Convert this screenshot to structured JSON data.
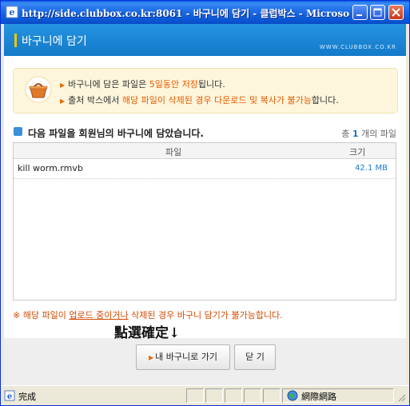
{
  "window": {
    "title": "http://side.clubbox.co.kr:8061 - 바구니에 담기 - 클럽박스 - Microsoft..."
  },
  "header": {
    "title": "바구니에 담기",
    "site": "WWW.CLUBBOX.CO.KR"
  },
  "notice": {
    "line1_pre": "바구니에 담은 파일은 ",
    "line1_hl": "5일동안 저장",
    "line1_post": "됩니다.",
    "line2_pre": "출처 박스에서 ",
    "line2_hl": "해당 파일이 삭제된 경우 다운로드 및 복사가 불가능",
    "line2_post": "합니다."
  },
  "section": {
    "title": "다음 파일을 회원님의 바구니에 담았습니다.",
    "count_pre": "총 ",
    "count": "1",
    "count_post": " 개의 파일"
  },
  "table": {
    "col_file": "파일",
    "col_size": "크기",
    "rows": [
      {
        "name": "kill worm.rmvb",
        "size": "42.1 MB"
      }
    ]
  },
  "warning": {
    "pre": "※ 해당 파일이 ",
    "link": "업로드 중이거나",
    "post": " 삭제된 경우 바구니 담기가 불가능합니다."
  },
  "annotation": "點選確定↓",
  "buttons": {
    "go_basket": "내 바구니로 가기",
    "close": "닫 기"
  },
  "statusbar": {
    "status": "完成",
    "zone": "網際網路"
  },
  "colors": {
    "titlebar": "#0b58d6",
    "header": "#1c87d6",
    "accent": "#e85a00",
    "link_blue": "#1c7bd0"
  }
}
